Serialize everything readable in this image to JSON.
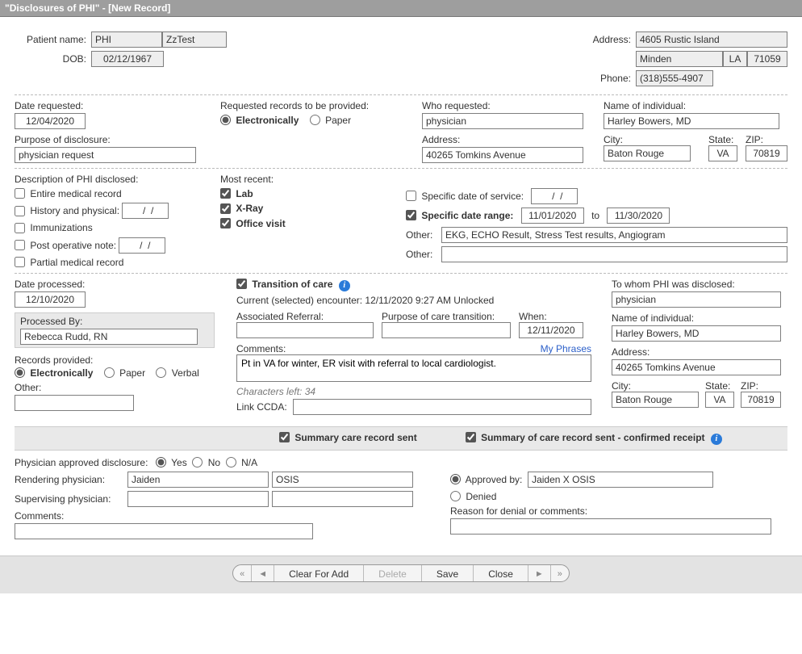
{
  "window": {
    "title": "\"Disclosures of PHI\" - [New Record]"
  },
  "patient": {
    "name_label": "Patient name:",
    "first": "PHI",
    "last": "ZzTest",
    "dob_label": "DOB:",
    "dob": "02/12/1967",
    "address_label": "Address:",
    "street": "4605 Rustic Island",
    "city": "Minden",
    "state": "LA",
    "zip": "71059",
    "phone_label": "Phone:",
    "phone": "(318)555-4907"
  },
  "request": {
    "date_requested_label": "Date requested:",
    "date_requested": "12/04/2020",
    "purpose_label": "Purpose of disclosure:",
    "purpose": "physician request",
    "records_provided_label": "Requested records to be provided:",
    "opt_electronic": "Electronically",
    "opt_paper": "Paper",
    "who_requested_label": "Who requested:",
    "who_requested": "physician",
    "name_ind_label": "Name of individual:",
    "name_ind": "Harley Bowers, MD",
    "address_label": "Address:",
    "address": "40265 Tomkins Avenue",
    "city_label": "City:",
    "city": "Baton Rouge",
    "state_label": "State:",
    "state": "VA",
    "zip_label": "ZIP:",
    "zip": "70819"
  },
  "description": {
    "heading": "Description of PHI disclosed:",
    "entire": "Entire medical record",
    "history": "History and physical:",
    "history_date": "  /  /",
    "immun": "Immunizations",
    "postop": "Post operative note:",
    "postop_date": "  /  /",
    "partial": "Partial medical record",
    "most_recent_label": "Most recent:",
    "lab": "Lab",
    "xray": "X-Ray",
    "office_visit": "Office visit",
    "spec_date_label": "Specific date of service:",
    "spec_date": "  /  /",
    "spec_range_label": "Specific date range:",
    "range_from": "11/01/2020",
    "range_to_label": "to",
    "range_to": "11/30/2020",
    "other_label": "Other:",
    "other1": "EKG, ECHO Result, Stress Test results, Angiogram",
    "other2_label": "Other:",
    "other2": ""
  },
  "processed": {
    "date_label": "Date processed:",
    "date": "12/10/2020",
    "by_label": "Processed By:",
    "by": "Rebecca Rudd, RN",
    "records_provided_label": "Records provided:",
    "opt_electronic": "Electronically",
    "opt_paper": "Paper",
    "opt_verbal": "Verbal",
    "other_label": "Other:",
    "other": ""
  },
  "transition": {
    "checkbox_label": "Transition of care",
    "encounter_label": "Current (selected) encounter:",
    "encounter_value": "12/11/2020 9:27 AM Unlocked",
    "assoc_ref_label": "Associated Referral:",
    "assoc_ref": "",
    "purpose_label": "Purpose of care transition:",
    "purpose": "",
    "when_label": "When:",
    "when": "12/11/2020",
    "comments_label": "Comments:",
    "my_phrases": "My Phrases",
    "comments": "Pt in VA for winter, ER visit with referral to local cardiologist.",
    "chars_left": "Characters left: 34",
    "link_ccda_label": "Link CCDA:",
    "link_ccda": ""
  },
  "disclosed_to": {
    "heading": "To whom PHI was disclosed:",
    "to": "physician",
    "name_ind_label": "Name of individual:",
    "name_ind": "Harley Bowers, MD",
    "address_label": "Address:",
    "address": "40265 Tomkins Avenue",
    "city_label": "City:",
    "city": "Baton Rouge",
    "state_label": "State:",
    "state": "VA",
    "zip_label": "ZIP:",
    "zip": "70819"
  },
  "summary": {
    "sent_label": "Summary care record sent",
    "confirmed_label": "Summary of care record sent - confirmed receipt"
  },
  "approval": {
    "phys_approved_label": "Physician approved disclosure:",
    "yes": "Yes",
    "no": "No",
    "na": "N/A",
    "rendering_label": "Rendering physician:",
    "rendering_first": "Jaiden",
    "rendering_last": "OSIS",
    "supervising_label": "Supervising physician:",
    "supervising_first": "",
    "supervising_last": "",
    "comments_label": "Comments:",
    "comments": "",
    "approved_by_label": "Approved   by:",
    "approved_by": "Jaiden X OSIS",
    "denied_label": "Denied",
    "reason_label": "Reason for denial or comments:",
    "reason": ""
  },
  "footer": {
    "clear": "Clear For Add",
    "delete": "Delete",
    "save": "Save",
    "close": "Close"
  }
}
